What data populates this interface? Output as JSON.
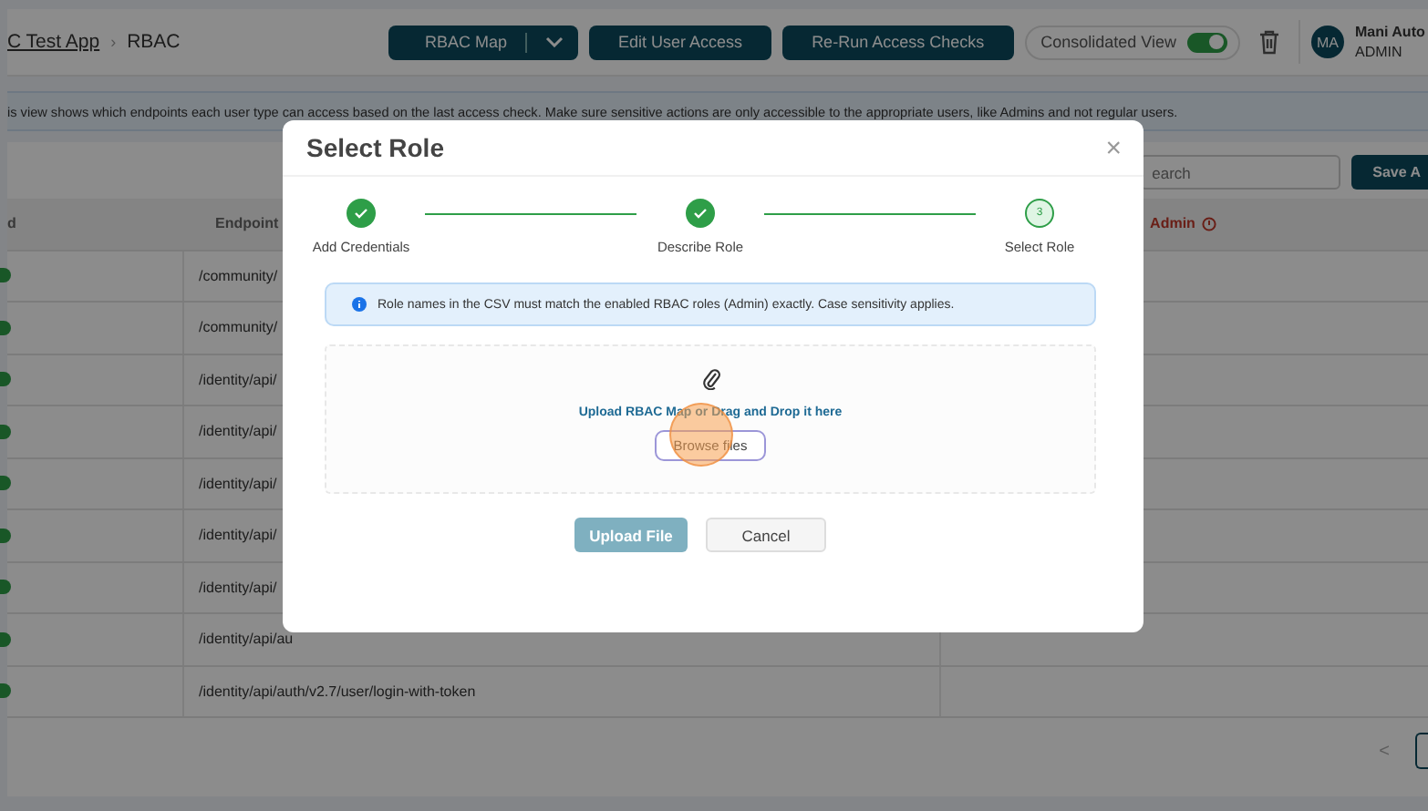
{
  "header": {
    "breadcrumb": [
      {
        "label": "C Test App",
        "link": true
      },
      {
        "label": "RBAC",
        "link": false
      }
    ],
    "separator": "›",
    "buttons": [
      {
        "label": "RBAC Map",
        "kind": "split"
      },
      {
        "label": "Edit User Access",
        "kind": "plain"
      },
      {
        "label": "Re-Run Access Checks",
        "kind": "plain"
      }
    ],
    "toggle": {
      "label": "Consolidated View",
      "on": true
    },
    "user": {
      "initials": "MA",
      "name": "Mani Auto",
      "role": "ADMIN"
    }
  },
  "banner": "is view shows which endpoints each user type can access based on the last access check. Make sure sensitive actions are only accessible to the appropriate users, like Admins and not regular users.",
  "toolbar": {
    "search_placeholder": "earch",
    "save_button": "Save A"
  },
  "table": {
    "columns": [
      "d",
      "Endpoint",
      "Admin"
    ],
    "rows": [
      {
        "endpoint": "/community/",
        "allowed": true
      },
      {
        "endpoint": "/community/",
        "allowed": true
      },
      {
        "endpoint": "/identity/api/",
        "allowed": true
      },
      {
        "endpoint": "/identity/api/",
        "allowed": true
      },
      {
        "endpoint": "/identity/api/",
        "allowed": true
      },
      {
        "endpoint": "/identity/api/",
        "allowed": true
      },
      {
        "endpoint": "/identity/api/",
        "allowed": true
      },
      {
        "endpoint": "/identity/api/au",
        "allowed": true
      },
      {
        "endpoint": "/identity/api/auth/v2.7/user/login-with-token",
        "allowed": true
      }
    ]
  },
  "pagination": {
    "prev": "<"
  },
  "modal": {
    "title": "Select Role",
    "close": "×",
    "steps": [
      {
        "label": "Add Credentials",
        "done": true
      },
      {
        "label": "Describe Role",
        "done": true
      },
      {
        "label": "Select Role",
        "done": false,
        "number": "3"
      }
    ],
    "alert": "Role names in the CSV must match the enabled RBAC roles (Admin) exactly. Case sensitivity applies.",
    "dropzone": {
      "text": "Upload RBAC Map or Drag and Drop it here",
      "browse": "Browse files"
    },
    "buttons": [
      {
        "label": "Upload File",
        "kind": "primary",
        "disabled": true
      },
      {
        "label": "Cancel",
        "kind": "secondary",
        "disabled": false
      }
    ]
  }
}
